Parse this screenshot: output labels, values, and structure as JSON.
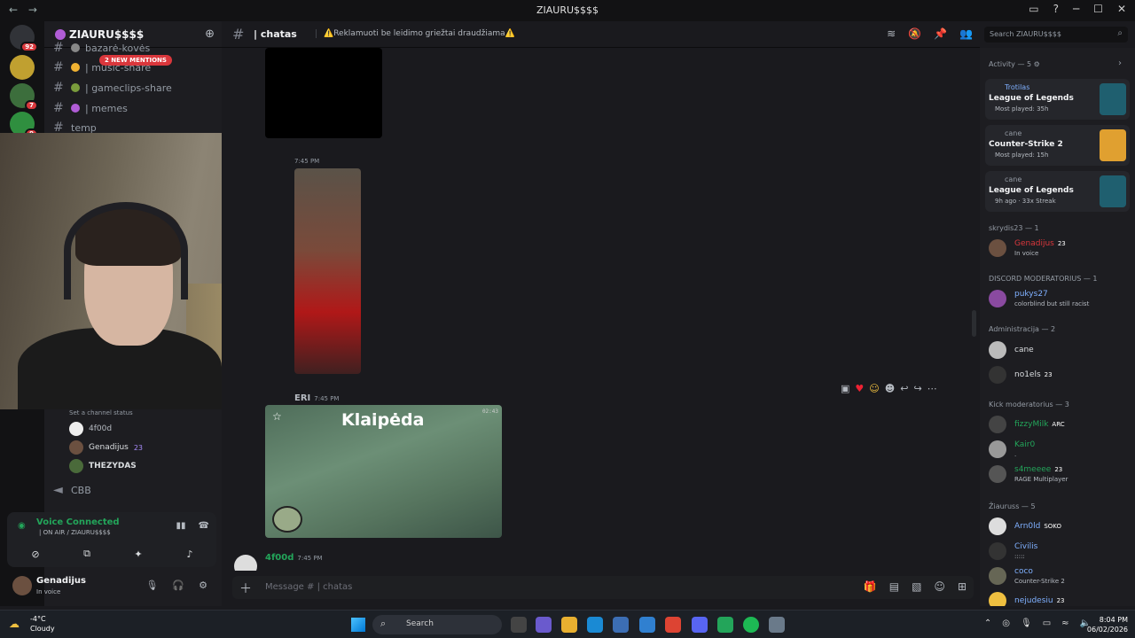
{
  "window": {
    "title": "ZIAURU$$$$",
    "nav": [
      "←",
      "→"
    ],
    "controls": [
      "─",
      "☐",
      "✕"
    ]
  },
  "rail": {
    "badges": [
      "92",
      "7",
      "9"
    ]
  },
  "server": {
    "name": "ZIAURU$$$$",
    "mentions": "2 NEW MENTIONS"
  },
  "channels": [
    {
      "name": "bazarė-kovės",
      "emoji_color": "#888"
    },
    {
      "name": "| music-share",
      "emoji_color": "#f0b232"
    },
    {
      "name": "| gameclips-share",
      "emoji_color": "#7a9c3c"
    },
    {
      "name": "| memes",
      "emoji_color": "#b05cd6"
    },
    {
      "name": "temp",
      "emoji_color": ""
    }
  ],
  "voice_channel": {
    "status": "Set a channel status",
    "users": [
      {
        "name": "4f00d",
        "boost": ""
      },
      {
        "name": "Genadijus",
        "boost": "23"
      },
      {
        "name": "THEZYDAS",
        "boost": ""
      }
    ],
    "next_channel": "CBB"
  },
  "voice_panel": {
    "status": "Voice Connected",
    "location": "| ON AIR / ZIAURU$$$$"
  },
  "user_panel": {
    "name": "Genadijus",
    "status": "In voice"
  },
  "chat": {
    "channel": "| chatas",
    "topic": "⚠️Reklamuoti be leidimo griežtai draudžiama⚠️",
    "search_placeholder": "Search ZIAURU$$$$",
    "messages": [
      {
        "time": "7:45 PM"
      },
      {
        "author": "ERI",
        "time": "7:45 PM",
        "video_title": "Klaipėda",
        "hud_time": "02:43"
      },
      {
        "author": "4f00d",
        "time": "7:45 PM"
      }
    ],
    "input_placeholder": "Message #",
    "input_channel": "| chatas"
  },
  "members": {
    "activity_header": "Activity — 5",
    "activities": [
      {
        "user": "Trotilas",
        "game": "League of Legends",
        "detail": "Most played: 35h",
        "art_color": "#1f5f6f"
      },
      {
        "user": "cane",
        "game": "Counter-Strike 2",
        "detail": "Most played: 15h",
        "art_color": "#e0a030"
      },
      {
        "user": "cane",
        "game": "League of Legends",
        "detail": "9h ago · 33x Streak",
        "art_color": "#1f5f6f"
      }
    ],
    "groups": [
      {
        "title": "skrydis23 — 1",
        "members": [
          {
            "name": "Genadijus",
            "tag": "23",
            "status": "In voice",
            "color": "#da373c"
          }
        ]
      },
      {
        "title": "DISCORD MODERATORIUS — 1",
        "members": [
          {
            "name": "pukys27",
            "tag": "",
            "status": "colorblind but still racist",
            "color": "#7fb0ff"
          }
        ]
      },
      {
        "title": "Administracija — 2",
        "members": [
          {
            "name": "cane",
            "tag": "",
            "status": "",
            "color": "#dbdee1"
          },
          {
            "name": "no1els",
            "tag": "23",
            "status": "",
            "color": "#dbdee1"
          }
        ]
      },
      {
        "title": "Kick moderatorius — 3",
        "members": [
          {
            "name": "fizzyMilk",
            "tag": "ARC",
            "status": "",
            "color": "#23a55a"
          },
          {
            "name": "Kair0",
            "tag": "",
            "status": ".",
            "color": "#23a55a"
          },
          {
            "name": "s4meeee",
            "tag": "23",
            "status": "RAGE Multiplayer",
            "color": "#23a55a"
          }
        ]
      },
      {
        "title": "Žiauruss — 5",
        "members": [
          {
            "name": "Arn0ld",
            "tag": "SOKO",
            "status": "",
            "color": "#7fb0ff"
          },
          {
            "name": "Civilis",
            "tag": "",
            "status": ":::::",
            "color": "#7fb0ff"
          },
          {
            "name": "coco",
            "tag": "",
            "status": "Counter-Strike 2",
            "color": "#7fb0ff"
          },
          {
            "name": "nejudesiu",
            "tag": "23",
            "status": "",
            "color": "#7fb0ff"
          }
        ]
      }
    ]
  },
  "taskbar": {
    "temp": "-4°C",
    "weather": "Cloudy",
    "search": "Search",
    "time": "8:04 PM",
    "date": "06/02/2026"
  }
}
